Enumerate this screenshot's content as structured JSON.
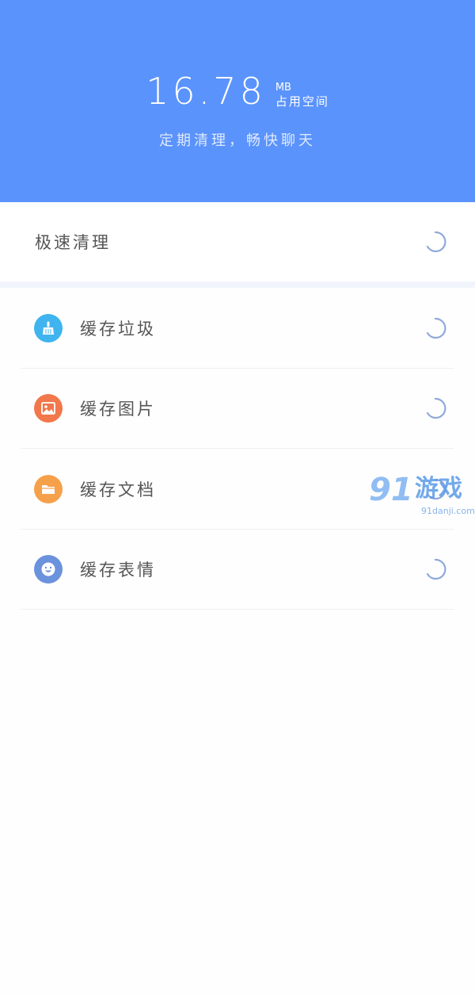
{
  "header": {
    "storage_value": "16.78",
    "storage_unit": "MB",
    "storage_label": "占用空间",
    "subtitle": "定期清理，畅快聊天",
    "bg_color": "#5a93fb"
  },
  "quick_clean": {
    "label": "极速清理",
    "status_icon": "loading-spinner-icon"
  },
  "items": [
    {
      "label": "缓存垃圾",
      "icon": "broom-icon",
      "color": "#3fb4ef"
    },
    {
      "label": "缓存图片",
      "icon": "image-icon",
      "color": "#f2774a"
    },
    {
      "label": "缓存文档",
      "icon": "folder-icon",
      "color": "#f6a04a"
    },
    {
      "label": "缓存表情",
      "icon": "smiley-icon",
      "color": "#6b92dc"
    }
  ],
  "watermark": {
    "number": "91",
    "text": "游戏",
    "url": "91danji.com"
  }
}
